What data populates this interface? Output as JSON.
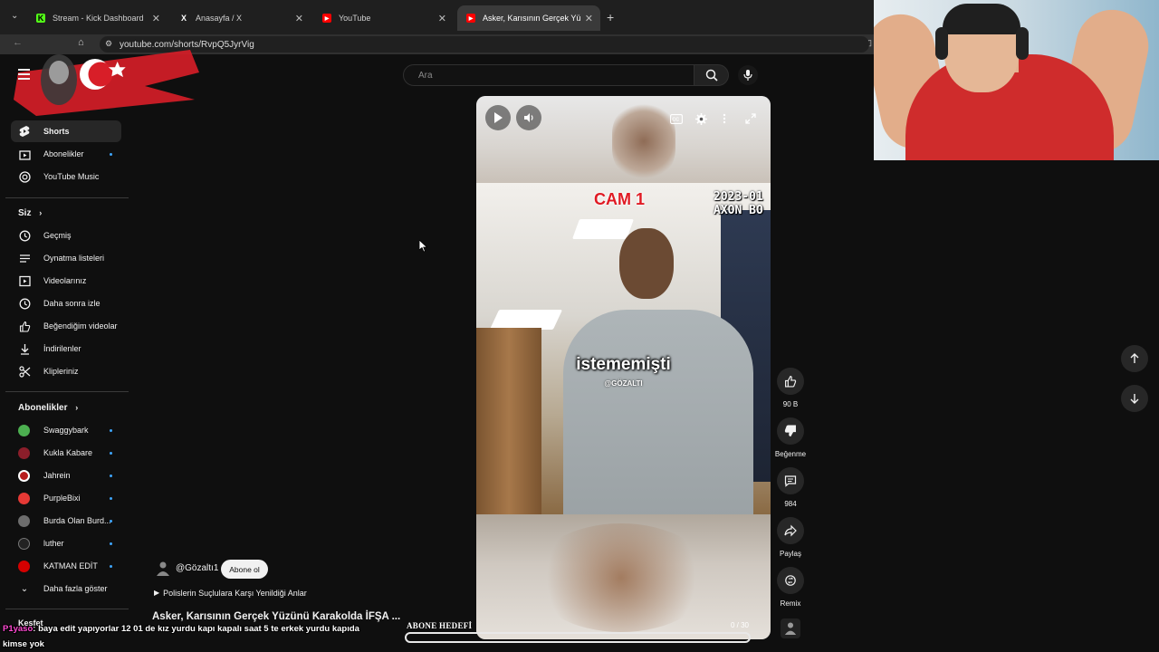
{
  "browser": {
    "tabs": [
      {
        "label": "Stream - Kick Dashboard",
        "active": false
      },
      {
        "label": "Anasayfa / X",
        "active": false
      },
      {
        "label": "YouTube",
        "active": false
      },
      {
        "label": "Asker, Karısının Gerçek Yüzünü",
        "active": true
      }
    ],
    "url": "youtube.com/shorts/RvpQ5JyrVig"
  },
  "search": {
    "placeholder": "Ara"
  },
  "sidebar": {
    "main": [
      {
        "label": "Shorts",
        "active": true
      },
      {
        "label": "Abonelikler"
      },
      {
        "label": "YouTube Music"
      }
    ],
    "you_header": "Siz",
    "you": [
      {
        "label": "Geçmiş"
      },
      {
        "label": "Oynatma listeleri"
      },
      {
        "label": "Videolarınız"
      },
      {
        "label": "Daha sonra izle"
      },
      {
        "label": "Beğendiğim videolar"
      },
      {
        "label": "İndirilenler"
      },
      {
        "label": "Klipleriniz"
      }
    ],
    "subs_header": "Abonelikler",
    "subs": [
      {
        "label": "Swaggybark",
        "color": "#4caf50"
      },
      {
        "label": "Kukla Kabare",
        "color": "#8b1e2a"
      },
      {
        "label": "Jahrein",
        "color": "#b71c1c"
      },
      {
        "label": "PurpleBixi",
        "color": "#e53935"
      },
      {
        "label": "Burda Olan Burd...",
        "color": "#6d6d6d"
      },
      {
        "label": "luther",
        "color": "#222222"
      },
      {
        "label": "KATMAN EDİT",
        "color": "#d50000"
      },
      {
        "label": "Daha fazla göster"
      }
    ],
    "explore_header": "Keşfet"
  },
  "video": {
    "cam_label": "CAM 1",
    "cam_date": "2023-01\nAXON BO",
    "subtitle": "istememişti",
    "watermark": "@GÖZALTI",
    "channel": "@Gözaltı1",
    "subscribe_label": "Abone ol",
    "playlist": "Polislerin Suçlulara Karşı Yenildiği Anlar",
    "title": "Asker, Karısının Gerçek Yüzünü Karakolda İFŞA ..."
  },
  "actions": {
    "like_count": "90 B",
    "dislike_label": "Beğenme",
    "comment_count": "984",
    "share_label": "Paylaş",
    "remix_label": "Remix"
  },
  "overlay": {
    "chat_user": "P1yaso",
    "chat_message": ": baya edit yapıyorlar 12 01 de kız yurdu kapı kapalı saat 5 te erkek yurdu kapıda kimse yok",
    "goal_label": "ABONE HEDEFİ",
    "goal_count": "0 / 30",
    "goal_progress": 0.0
  },
  "colors": {
    "accent": "#3ea6ff",
    "background": "#0f0f0f",
    "brand_red": "#ff0000"
  }
}
